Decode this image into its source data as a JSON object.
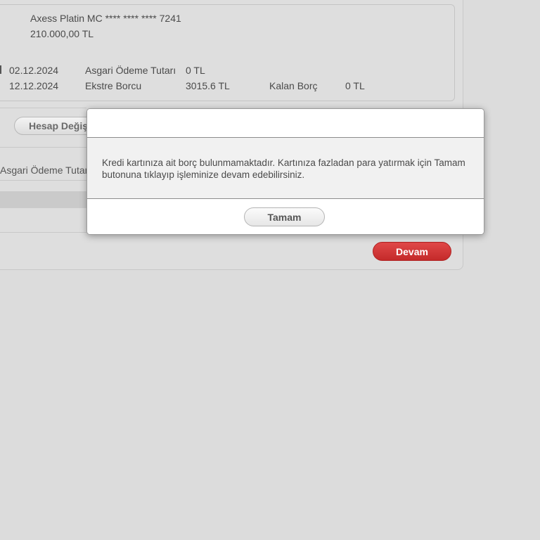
{
  "card": {
    "name": "Axess Platin MC **** **** **** 7241",
    "limit": "210.000,00 TL"
  },
  "summary": {
    "row1": {
      "date": "02.12.2024",
      "label": "Asgari Ödeme Tutarı",
      "value": "0 TL"
    },
    "row2": {
      "date": "12.12.2024",
      "label": "Ekstre Borcu",
      "value": "3015.6 TL",
      "extra_label": "Kalan Borç",
      "extra_value": "0 TL"
    }
  },
  "form": {
    "hesap_button_label": "Hesap Değiştir",
    "asgari_label": "Asgari Ödeme Tutarı",
    "devam_button_label": "Devam"
  },
  "dialog": {
    "message": "Kredi kartınıza ait borç bulunmamaktadır. Kartınıza fazladan para yatırmak için Tamam butonuna tıklayıp işleminize devam edebilirsiniz.",
    "ok_button_label": "Tamam"
  },
  "colors": {
    "primary_red": "#d23a3a",
    "background": "#dcdcdc"
  }
}
